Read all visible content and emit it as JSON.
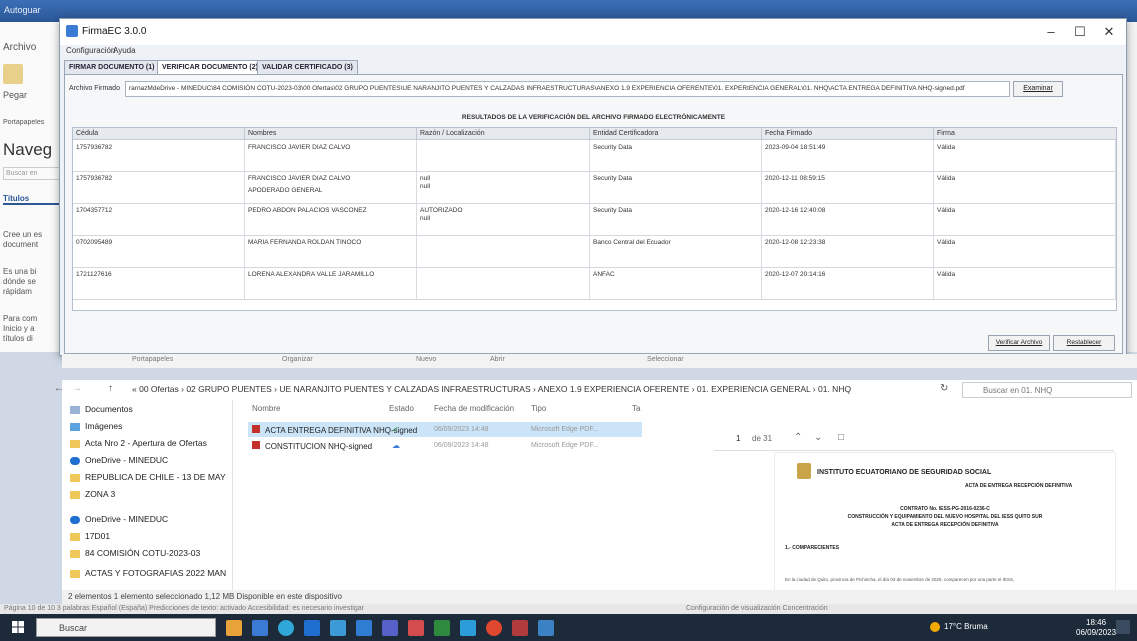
{
  "word": {
    "autosave": "Autoguar",
    "archivo": "Archivo",
    "pegar": "Pegar",
    "portapapeles": "Portapapeles",
    "nav_title": "Naveg",
    "search_placeholder": "Buscar en",
    "titulos_tab": "Títulos",
    "left_texts": [
      "Cree un es",
      "document",
      "Es una bi",
      "dónde se",
      "rápidam",
      "Para com",
      "Inicio y a",
      "títulos di"
    ]
  },
  "dialog": {
    "title": "FirmaEC 3.0.0",
    "menu": [
      "Configuración",
      "Ayuda"
    ],
    "tabs": [
      "FIRMAR DOCUMENTO (1)",
      "VERIFICAR DOCUMENTO (2)",
      "VALIDAR CERTIFICADO (3)"
    ],
    "archivo_label": "Archivo Firmado",
    "archivo_path": "rarnazMdeDrive - MINEDUC\\84 COMISIÓN COTU-2023-03\\00 Ofertas\\02 GRUPO PUENTES\\UE NARANJITO PUENTES Y CALZADAS INFRAESTRUCTURAS\\ANEXO 1.9 EXPERIENCIA OFERENTE\\01. EXPERIENCIA GENERAL\\01. NHQ\\ACTA ENTREGA DEFINITIVA NHQ-signed.pdf",
    "examinar": "Examinar",
    "results_title": "RESULTADOS DE LA VERIFICACIÓN DEL ARCHIVO FIRMADO ELECTRÓNICAMENTE",
    "columns": [
      "Cédula",
      "Nombres",
      "Razón / Localización",
      "Entidad Certificadora",
      "Fecha Firmado",
      "Firma"
    ],
    "rows": [
      {
        "cedula": "1757936782",
        "nombres": "FRANCISCO JAVIER DIAZ CALVO",
        "nombres2": "",
        "razon": "",
        "razon2": "",
        "entidad": "Security Data",
        "fecha": "2023-09-04 18:51:49",
        "firma": "Válida"
      },
      {
        "cedula": "1757936782",
        "nombres": "FRANCISCO JAVIER DIAZ CALVO",
        "nombres2": "APODERADO GENERAL",
        "razon": "null",
        "razon2": "null",
        "entidad": "Security Data",
        "fecha": "2020-12-11 08:59:15",
        "firma": "Válida"
      },
      {
        "cedula": "1704357712",
        "nombres": "PEDRO ABDON PALACIOS VASCONEZ",
        "nombres2": "",
        "razon": "AUTORIZADO",
        "razon2": "null",
        "entidad": "Security Data",
        "fecha": "2020-12-16 12:40:08",
        "firma": "Válida"
      },
      {
        "cedula": "0702095489",
        "nombres": "MARIA FERNANDA ROLDAN TINOCO",
        "nombres2": "",
        "razon": "",
        "razon2": "",
        "entidad": "Banco Central del Ecuador",
        "fecha": "2020-12-08 12:23:38",
        "firma": "Válida"
      },
      {
        "cedula": "1721127616",
        "nombres": "LORENA ALEXANDRA VALLE JARAMILLO",
        "nombres2": "",
        "razon": "",
        "razon2": "",
        "entidad": "ANFAC",
        "fecha": "2020-12-07 20:14:16",
        "firma": "Válida"
      }
    ],
    "verificar": "Verificar Archivo",
    "restablecer": "Restablecer"
  },
  "ribbon_captions": [
    "Portapapeles",
    "Organizar",
    "Nuevo",
    "Abrir",
    "Seleccionar"
  ],
  "explorer": {
    "breadcrumb": "« 00 Ofertas › 02 GRUPO PUENTES › UE NARANJITO PUENTES Y CALZADAS INFRAESTRUCTURAS › ANEXO 1.9 EXPERIENCIA OFERENTE › 01. EXPERIENCIA GENERAL › 01. NHQ",
    "search": "Buscar en 01. NHQ",
    "nav": [
      "Documentos",
      "Imágenes",
      "Acta Nro 2 - Apertura de Ofertas",
      "OneDrive - MINEDUC",
      "REPUBLICA DE CHILE - 13 DE MAY",
      "ZONA 3",
      "OneDrive - MINEDUC",
      "17D01",
      "84 COMISIÓN COTU-2023-03",
      "ACTAS Y FOTOGRAFIAS 2022 MAN"
    ],
    "headers": [
      "Nombre",
      "Estado",
      "Fecha de modificación",
      "Tipo",
      "Ta"
    ],
    "files": [
      {
        "name": "ACTA ENTREGA DEFINITIVA NHQ-signed",
        "date": "06/09/2023 14:48",
        "type": "Microsoft Edge PDF..."
      },
      {
        "name": "CONSTITUCION NHQ-signed",
        "date": "06/09/2023 14:48",
        "type": "Microsoft Edge PDF..."
      }
    ],
    "pdf_page": "1",
    "pdf_of": "de 31",
    "pdf": {
      "org": "INSTITUTO ECUATORIANO DE SEGURIDAD SOCIAL",
      "acta_header": "ACTA DE ENTREGA RECEPCIÓN DEFINITIVA",
      "contrato": "CONTRATO No. IESS-PG-2016-0236-C",
      "obra": "CONSTRUCCIÓN Y EQUIPAMIENTO DEL NUEVO HOSPITAL DEL IESS QUITO SUR",
      "acta": "ACTA DE ENTREGA RECEPCIÓN DEFINITIVA",
      "section": "1.- COMPARECIENTES",
      "body": "En la ciudad de Quito, provincia de Pichincha, el día 03 de noviembre de 2020, comparecen por una parte el IESS,"
    },
    "status": "2 elementos    1 elemento seleccionado  1,12 MB    Disponible en este dispositivo"
  },
  "word_status": {
    "left": "Página 10 de 10    3 palabras    Español (España)    Predicciones de texto: activado    Accesibilidad: es necesario investigar",
    "right": "Configuración de visualización    Concentración"
  },
  "taskbar": {
    "search": "Buscar",
    "weather": "17°C Bruma",
    "time": "18:46",
    "date": "06/09/2023"
  }
}
